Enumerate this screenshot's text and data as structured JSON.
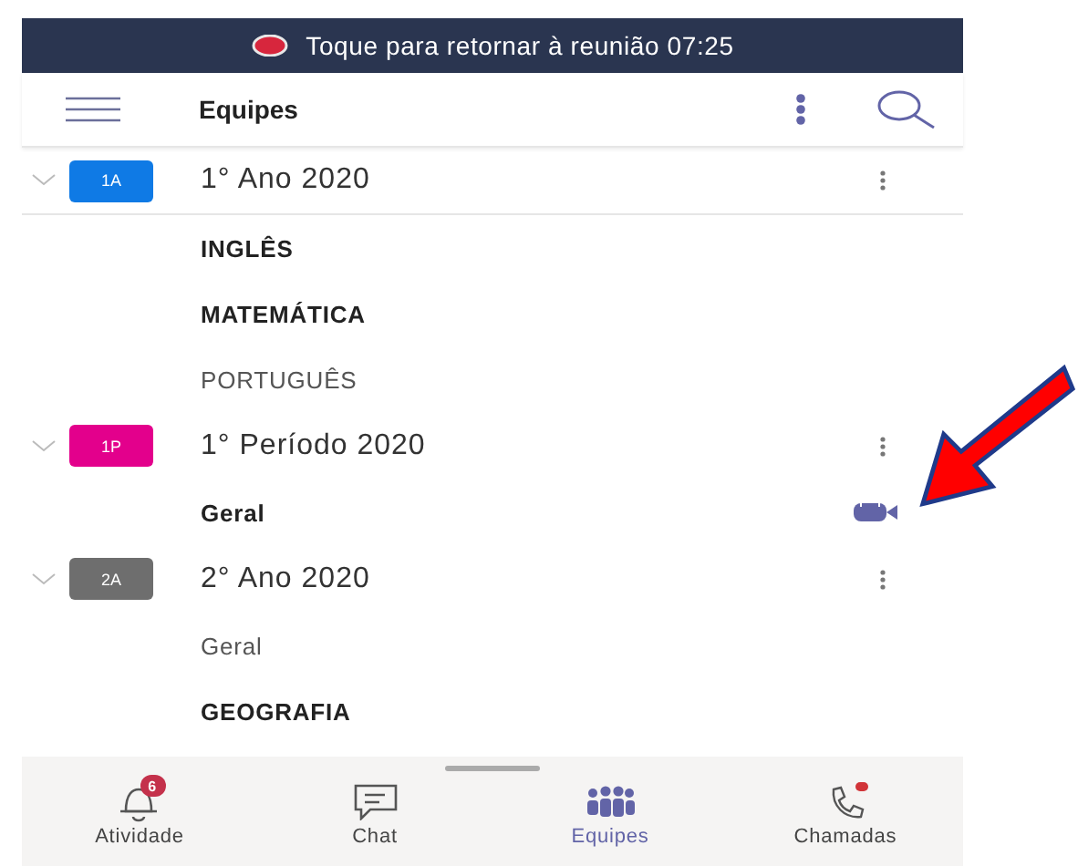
{
  "meeting_banner": {
    "text": "Toque para retornar à reunião 07:25"
  },
  "header": {
    "title": "Equipes"
  },
  "teams": [
    {
      "initials": "1A",
      "color": "#0f7ae5",
      "name": "1° Ano 2020",
      "expanded": true,
      "channels": [
        {
          "name": "INGLÊS",
          "unread": true,
          "in_meeting": false
        },
        {
          "name": "MATEMÁTICA",
          "unread": true,
          "in_meeting": false
        },
        {
          "name": "PORTUGUÊS",
          "unread": false,
          "in_meeting": false
        }
      ]
    },
    {
      "initials": "1P",
      "color": "#e3008c",
      "name": "1° Período 2020",
      "expanded": true,
      "channels": [
        {
          "name": "Geral",
          "unread": true,
          "in_meeting": true
        }
      ]
    },
    {
      "initials": "2A",
      "color": "#6e6e6e",
      "name": "2° Ano 2020",
      "expanded": true,
      "channels": [
        {
          "name": "Geral",
          "unread": false,
          "in_meeting": false
        },
        {
          "name": "GEOGRAFIA",
          "unread": true,
          "in_meeting": false
        }
      ]
    }
  ],
  "nav": [
    {
      "kind": "activity",
      "label": "Atividade",
      "badge": "6",
      "selected": false
    },
    {
      "kind": "chat",
      "label": "Chat",
      "selected": false
    },
    {
      "kind": "teams",
      "label": "Equipes",
      "selected": true
    },
    {
      "kind": "calls",
      "label": "Chamadas",
      "dot": true,
      "selected": false
    }
  ]
}
